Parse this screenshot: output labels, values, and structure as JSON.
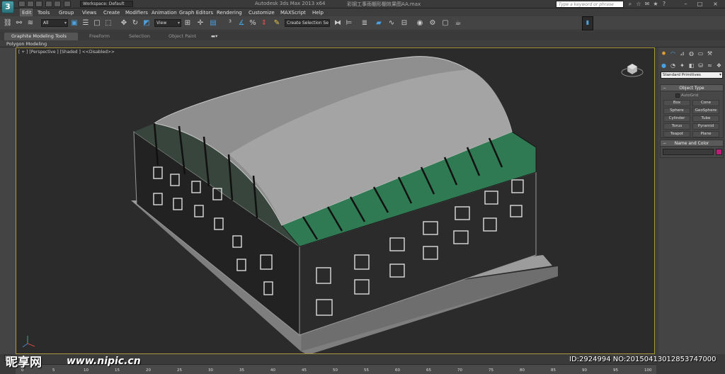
{
  "title_bar": {
    "workspace": "Workspace: Default",
    "app_title": "Autodesk 3ds Max  2013 x64",
    "file_title": "彩钢工事雨棚形棚效果图AA.max",
    "search_placeholder": "Type a keyword or phrase"
  },
  "menu": [
    "Edit",
    "Tools",
    "Group",
    "Views",
    "Create",
    "Modifiers",
    "Animation",
    "Graph Editors",
    "Rendering",
    "Customize",
    "MAXScript",
    "Help"
  ],
  "toolbar": {
    "filter_value": "All",
    "refcoord_value": "View",
    "selection_set_placeholder": "Create Selection Se"
  },
  "ribbon": {
    "tabs": [
      "Graphite Modeling Tools",
      "Freeform",
      "Selection",
      "Object Paint"
    ],
    "sub_label": "Polygon Modeling"
  },
  "viewport": {
    "label": "[ + ] [Perspective ] [Shaded ]  <<Disabled>>",
    "colors": {
      "roof": "#8f8f8f",
      "wall": "#2a2a2a",
      "glass": "#2f7a52",
      "base": "#8a8a8a",
      "border": "#a89a3a"
    }
  },
  "command_panel": {
    "category_value": "Standard Primitives",
    "object_type": {
      "header": "Object Type",
      "autogrid_label": "AutoGrid",
      "buttons": [
        "Box",
        "Cone",
        "Sphere",
        "GeoSphere",
        "Cylinder",
        "Tube",
        "Torus",
        "Pyramid",
        "Teapot",
        "Plane"
      ]
    },
    "name_color": {
      "header": "Name and Color",
      "swatch_color": "#c01c7a"
    }
  },
  "timeline": {
    "ticks": [
      "0",
      "5",
      "10",
      "15",
      "20",
      "25",
      "30",
      "35",
      "40",
      "45",
      "50",
      "55",
      "60",
      "65",
      "70",
      "75",
      "80",
      "85",
      "90",
      "95",
      "100"
    ]
  },
  "watermarks": {
    "logo": "昵享网",
    "site": "www.nipic.cn",
    "id_text": "ID:2924994 NO:20150413012853747000"
  }
}
